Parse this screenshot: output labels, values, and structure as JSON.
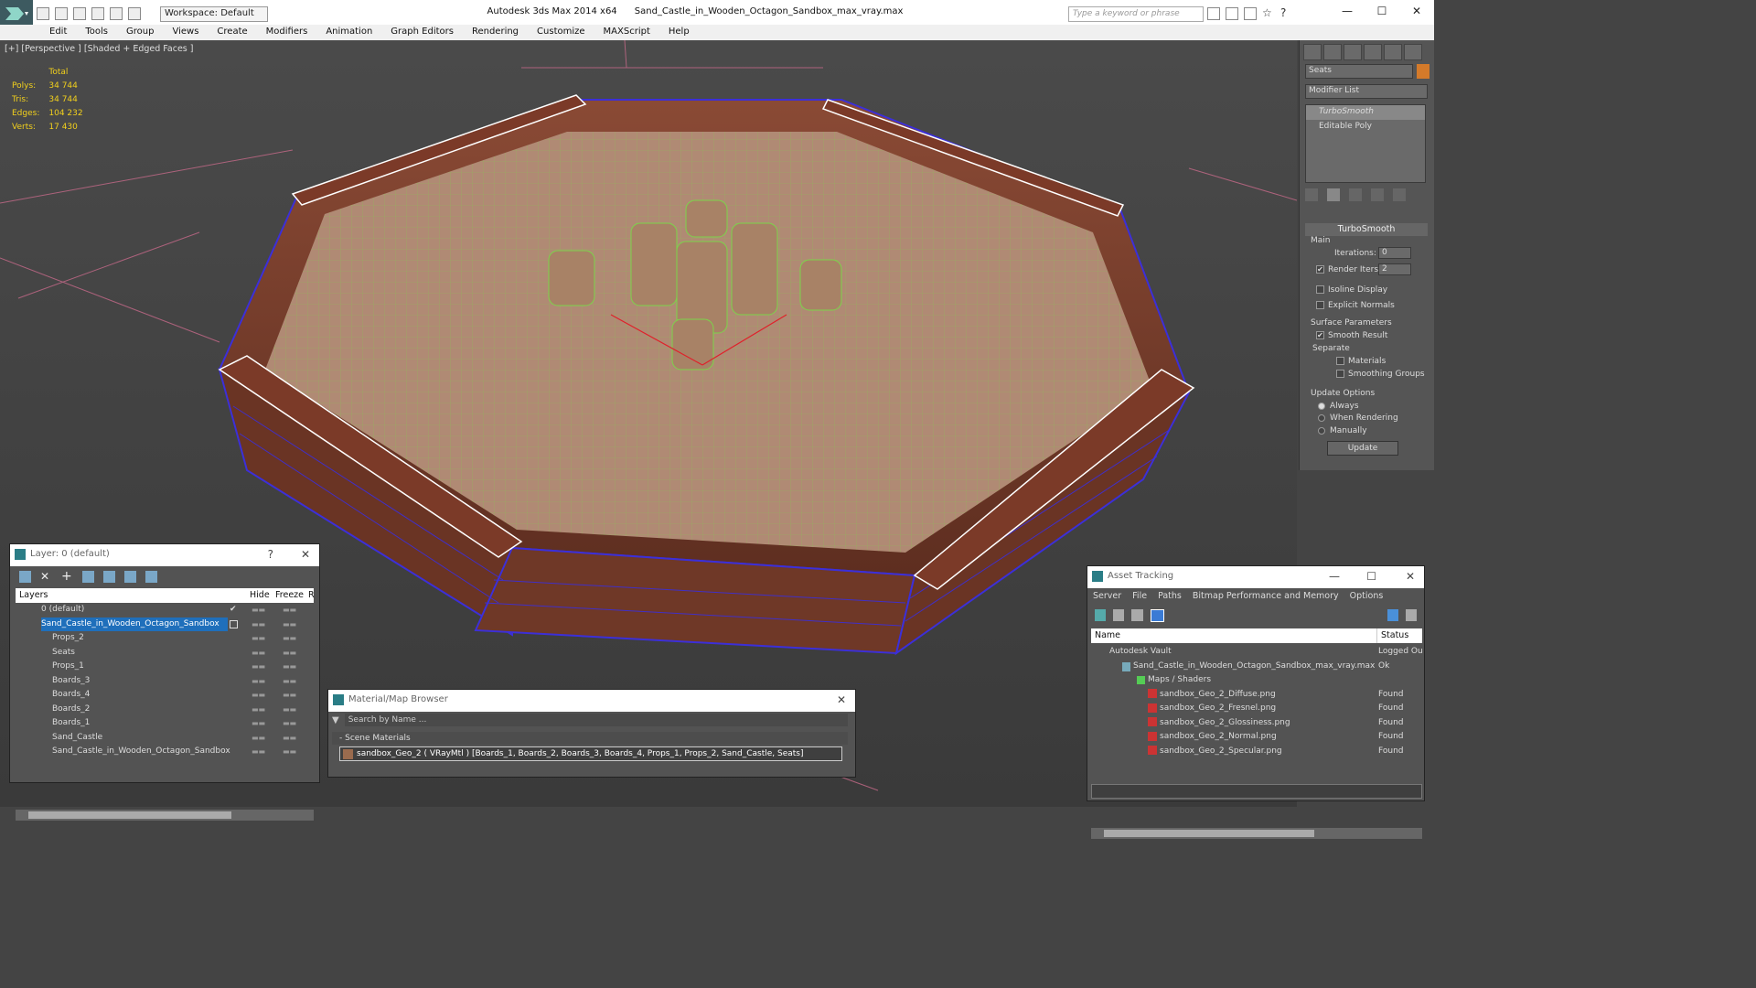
{
  "titlebar": {
    "workspace": "Workspace: Default",
    "app": "Autodesk 3ds Max  2014 x64",
    "file": "Sand_Castle_in_Wooden_Octagon_Sandbox_max_vray.max",
    "search_placeholder": "Type a keyword or phrase",
    "minimize": "—",
    "maximize": "☐",
    "close": "✕"
  },
  "menu": [
    "Edit",
    "Tools",
    "Group",
    "Views",
    "Create",
    "Modifiers",
    "Animation",
    "Graph Editors",
    "Rendering",
    "Customize",
    "MAXScript",
    "Help"
  ],
  "viewport": {
    "label": "[+] [Perspective ] [Shaded + Edged Faces ]",
    "stats_header": "Total",
    "stats": [
      {
        "k": "Polys:",
        "v": "34 744"
      },
      {
        "k": "Tris:",
        "v": "34 744"
      },
      {
        "k": "Edges:",
        "v": "104 232"
      },
      {
        "k": "Verts:",
        "v": "17 430"
      }
    ]
  },
  "command_panel": {
    "object_name": "Seats",
    "modifier_list": "Modifier List",
    "stack": [
      "TurboSmooth",
      "Editable Poly"
    ],
    "rollout": "TurboSmooth",
    "main": "Main",
    "iterations_label": "Iterations:",
    "iterations": "0",
    "render_iters_label": "Render Iters:",
    "render_iters": "2",
    "isoline": "Isoline Display",
    "explicit_normals": "Explicit Normals",
    "surface_params": "Surface Parameters",
    "smooth_result": "Smooth Result",
    "separate": "Separate",
    "materials": "Materials",
    "smoothing_groups": "Smoothing Groups",
    "update_options": "Update Options",
    "always": "Always",
    "when_rendering": "When Rendering",
    "manually": "Manually",
    "update_button": "Update"
  },
  "layer_window": {
    "title": "Layer: 0 (default)",
    "help": "?",
    "close": "✕",
    "col_layers": "Layers",
    "col_hide": "Hide",
    "col_freeze": "Freeze",
    "col_r": "R",
    "rows": [
      "0 (default)",
      "Sand_Castle_in_Wooden_Octagon_Sandbox",
      "Props_2",
      "Seats",
      "Props_1",
      "Boards_3",
      "Boards_4",
      "Boards_2",
      "Boards_1",
      "Sand_Castle",
      "Sand_Castle_in_Wooden_Octagon_Sandbox"
    ],
    "check": "✔",
    "dots": "▬▬"
  },
  "material_browser": {
    "title": "Material/Map Browser",
    "close": "✕",
    "search": "Search by Name ...",
    "section": "- Scene Materials",
    "item": "sandbox_Geo_2  ( VRayMtl ) [Boards_1, Boards_2, Boards_3, Boards_4, Props_1, Props_2, Sand_Castle, Seats]"
  },
  "asset_tracking": {
    "title": "Asset Tracking",
    "minimize": "—",
    "maximize": "☐",
    "close": "✕",
    "menu": [
      "Server",
      "File",
      "Paths",
      "Bitmap Performance and Memory",
      "Options"
    ],
    "col_name": "Name",
    "col_status": "Status",
    "rows": [
      {
        "name": "Autodesk Vault",
        "status": "Logged Ou"
      },
      {
        "name": "Sand_Castle_in_Wooden_Octagon_Sandbox_max_vray.max",
        "status": "Ok"
      },
      {
        "name": "Maps / Shaders",
        "status": ""
      },
      {
        "name": "sandbox_Geo_2_Diffuse.png",
        "status": "Found"
      },
      {
        "name": "sandbox_Geo_2_Fresnel.png",
        "status": "Found"
      },
      {
        "name": "sandbox_Geo_2_Glossiness.png",
        "status": "Found"
      },
      {
        "name": "sandbox_Geo_2_Normal.png",
        "status": "Found"
      },
      {
        "name": "sandbox_Geo_2_Specular.png",
        "status": "Found"
      }
    ]
  }
}
